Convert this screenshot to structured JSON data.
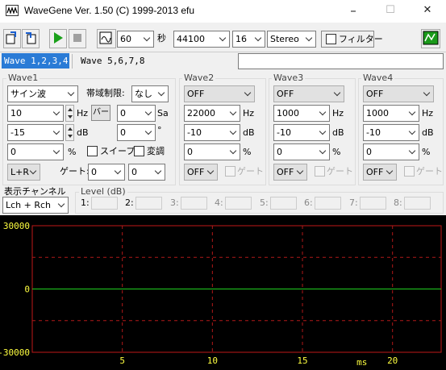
{
  "window": {
    "title": "WaveGene  Ver. 1.50  (C) 1999-2013 efu",
    "minimize": "–",
    "maximize": "☐",
    "close": "✕"
  },
  "toolbar": {
    "duration_value": "60",
    "duration_unit": "秒",
    "sample_rate": "44100",
    "bit_depth": "16",
    "channels": "Stereo",
    "filter_label": "フィルター"
  },
  "tabs": [
    {
      "label": "Wave 1,2,3,4",
      "active": true
    },
    {
      "label": "Wave 5,6,7,8",
      "active": false
    }
  ],
  "wave1": {
    "title": "Wave1",
    "waveform": "サイン波",
    "band_limit_label": "帯域制限:",
    "band_limit": "なし",
    "freq": "10",
    "freq_unit": "Hz",
    "bar_button": "バー",
    "sa_value": "0",
    "sa_unit": "Sa",
    "level": "-15",
    "level_unit": "dB",
    "phase": "0",
    "phase_unit": "°",
    "offset": "0",
    "offset_unit": "%",
    "sweep_label": "スイープ",
    "modulation_label": "変調",
    "channel": "L+R",
    "gate_label": "ゲート:",
    "gate_a": "0",
    "gate_b": "0"
  },
  "waves": [
    {
      "title": "Wave2",
      "waveform": "OFF",
      "freq": "22000",
      "freq_unit": "Hz",
      "level": "-10",
      "level_unit": "dB",
      "offset": "0",
      "offset_unit": "%",
      "switch": "OFF",
      "gate_label": "ゲート"
    },
    {
      "title": "Wave3",
      "waveform": "OFF",
      "freq": "1000",
      "freq_unit": "Hz",
      "level": "-10",
      "level_unit": "dB",
      "offset": "0",
      "offset_unit": "%",
      "switch": "OFF",
      "gate_label": "ゲート"
    },
    {
      "title": "Wave4",
      "waveform": "OFF",
      "freq": "1000",
      "freq_unit": "Hz",
      "level": "-10",
      "level_unit": "dB",
      "offset": "0",
      "offset_unit": "%",
      "switch": "OFF",
      "gate_label": "ゲート"
    }
  ],
  "display": {
    "channel_label": "表示チャンネル",
    "channel": "Lch + Rch"
  },
  "levels": {
    "title": "Level (dB)",
    "labels": [
      "1:",
      "2:",
      "3:",
      "4:",
      "5:",
      "6:",
      "7:",
      "8:"
    ]
  },
  "scope": {
    "y_labels": [
      "30000",
      "0",
      "-30000"
    ],
    "x_labels": [
      "5",
      "10",
      "15",
      "20"
    ],
    "x_unit": "ms",
    "colors": {
      "frame": "#c01818",
      "grid": "#b01818",
      "axis_text": "#ffff40",
      "trace": "#20d020"
    }
  }
}
